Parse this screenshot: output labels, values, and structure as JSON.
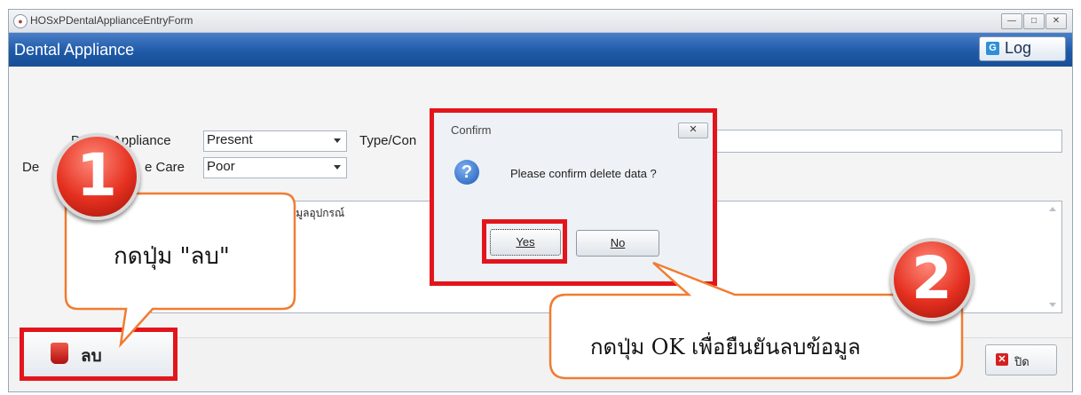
{
  "window": {
    "title": "HOSxPDentalApplianceEntryForm",
    "minimize_glyph": "—",
    "maximize_glyph": "□",
    "close_glyph": "✕"
  },
  "header": {
    "title": "Dental Appliance",
    "log_label": "Log",
    "log_icon_glyph": "G"
  },
  "form": {
    "dental_appliance_label": "Dental Appliance",
    "dental_appliance_value": "Present",
    "type_label": "Type/Con",
    "care_label_left": "De",
    "care_label_right": "e Care",
    "care_value": "Poor",
    "memo_text": "้อมูลอุปกรณ์"
  },
  "footer": {
    "delete_label": "ลบ",
    "close_label": "ปิด",
    "close_icon_glyph": "✕"
  },
  "dialog": {
    "title": "Confirm",
    "close_glyph": "✕",
    "icon_glyph": "?",
    "message": "Please confirm delete data ?",
    "yes_label": "Yes",
    "no_label": "No"
  },
  "callouts": {
    "step1_number": "1",
    "step1_text": "กดปุ่ม \"ลบ\"",
    "step2_number": "2",
    "step2_text": "กดปุ่ม OK เพื่อยืนยันลบข้อมูล"
  },
  "colors": {
    "header_blue": "#1f5aa8",
    "highlight_red": "#e3151c",
    "callout_border": "#f07c32"
  }
}
